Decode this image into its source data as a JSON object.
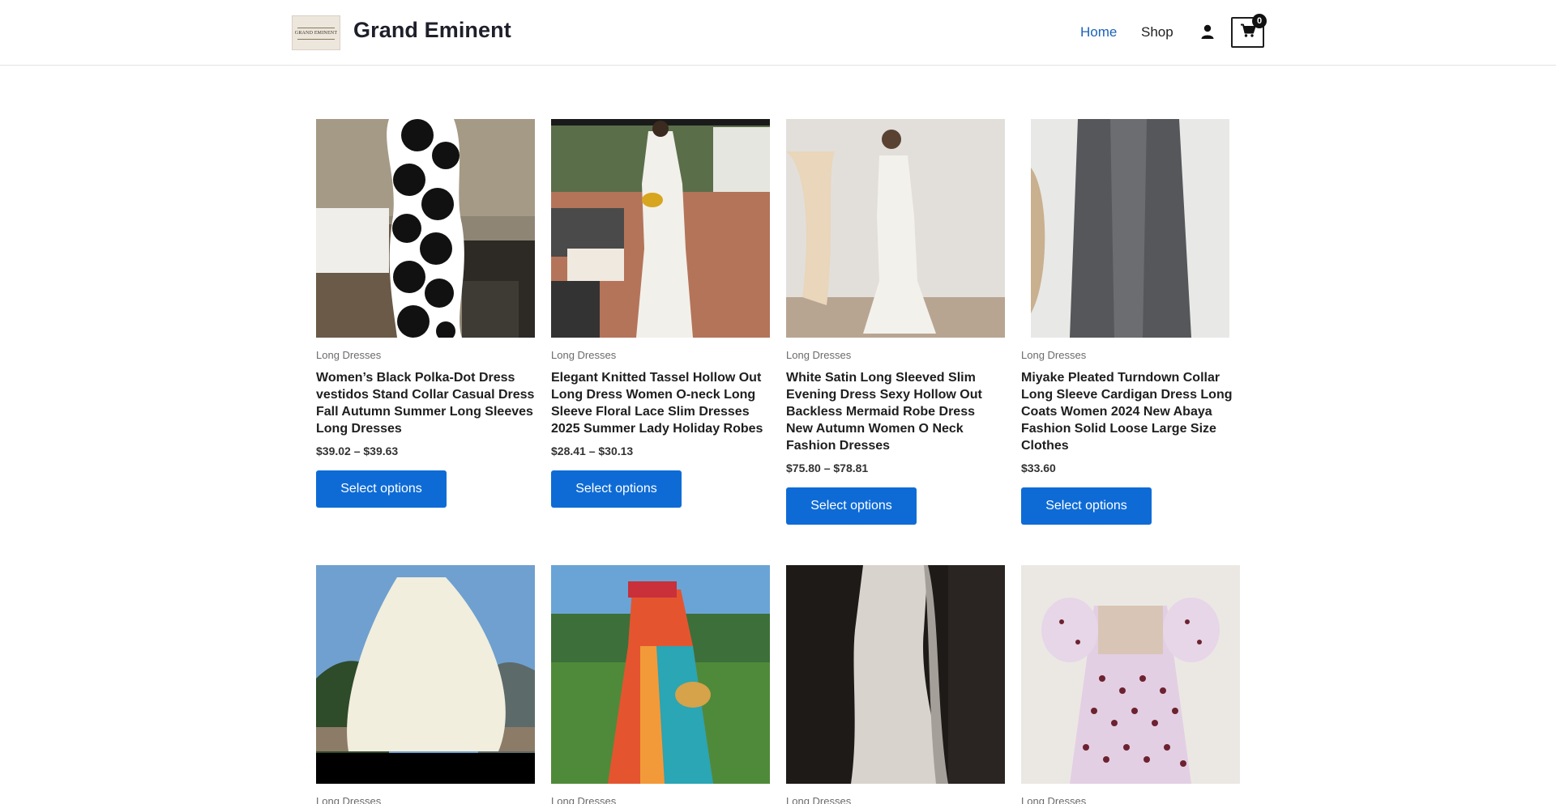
{
  "header": {
    "logo_text": "GRAND EMINENT",
    "site_title": "Grand Eminent",
    "nav": {
      "home": "Home",
      "shop": "Shop"
    },
    "cart_count": "0",
    "icons": {
      "account": "user-icon",
      "cart": "cart-icon"
    },
    "colors": {
      "active_nav": "#1a62b8",
      "button": "#0e6bd6"
    }
  },
  "products": [
    {
      "category": "Long Dresses",
      "title": "Women’s Black Polka-Dot Dress vestidos Stand Collar Casual Dress Fall Autumn Summer Long Sleeves Long Dresses",
      "price": "$39.02 – $39.63",
      "button": "Select options"
    },
    {
      "category": "Long Dresses",
      "title": "Elegant Knitted Tassel Hollow Out Long Dress Women O-neck Long Sleeve Floral Lace Slim Dresses 2025 Summer Lady Holiday Robes",
      "price": "$28.41 – $30.13",
      "button": "Select options"
    },
    {
      "category": "Long Dresses",
      "title": "White Satin Long Sleeved Slim Evening Dress Sexy Hollow Out Backless Mermaid Robe Dress New Autumn Women O Neck Fashion Dresses",
      "price": "$75.80 – $78.81",
      "button": "Select options"
    },
    {
      "category": "Long Dresses",
      "title": "Miyake Pleated Turndown Collar Long Sleeve Cardigan Dress Long Coats Women 2024 New Abaya Fashion Solid Loose Large Size Clothes",
      "price": "$33.60",
      "button": "Select options"
    },
    {
      "category": "Long Dresses"
    },
    {
      "category": "Long Dresses"
    },
    {
      "category": "Long Dresses"
    },
    {
      "category": "Long Dresses"
    }
  ]
}
